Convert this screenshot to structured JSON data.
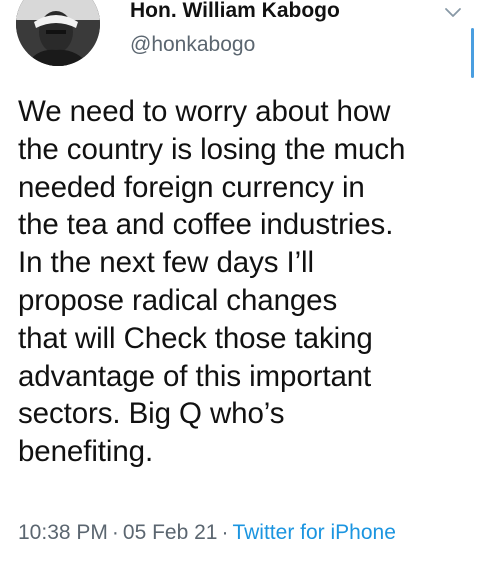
{
  "author": {
    "display_name": "Hon. William Kabogo",
    "handle": "@honkabogo"
  },
  "tweet": {
    "lines": [
      "We need to worry about how",
      "the country is losing the much",
      "needed foreign currency in",
      "the tea and coffee industries.",
      "In the next few days I’ll",
      "propose radical changes",
      "that will Check those taking",
      "advantage of this important",
      "sectors. Big Q who’s",
      "benefiting."
    ]
  },
  "meta": {
    "time": "10:38 PM",
    "separator": "·",
    "date": "05 Feb 21",
    "source": "Twitter for iPhone"
  },
  "icons": {
    "avatar": "profile-photo",
    "menu": "chevron-down-icon"
  },
  "colors": {
    "text": "#111111",
    "secondary": "#5b6670",
    "link": "#1b95e0"
  }
}
